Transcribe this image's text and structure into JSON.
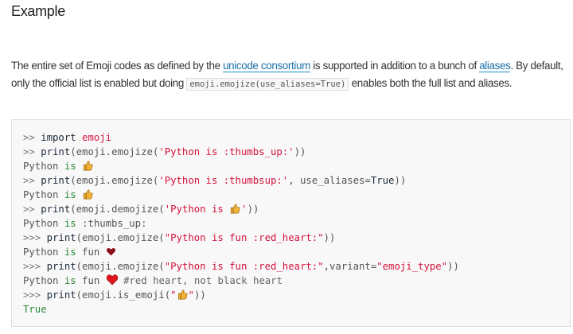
{
  "heading": "Example",
  "paragraph": {
    "t1": "The entire set of Emoji codes as defined by the ",
    "link1": "unicode consortium",
    "t2": " is supported in addition to a bunch of ",
    "link2": "aliases",
    "t3": ". By default, only the official list is enabled but doing ",
    "code": "emoji.emojize(use_aliases=True)",
    "t4": " enables both the full list and aliases."
  },
  "code_lines": [
    [
      [
        "p",
        ">> "
      ],
      [
        "k",
        "import"
      ],
      [
        "t",
        " "
      ],
      [
        "n",
        "emoji"
      ]
    ],
    [
      [
        "p",
        ">> "
      ],
      [
        "k",
        "print"
      ],
      [
        "t",
        "(emoji.emojize("
      ],
      [
        "s",
        "'Python is :thumbs_up:'"
      ],
      [
        "t",
        "))"
      ]
    ],
    [
      [
        "t",
        "Python "
      ],
      [
        "g",
        "is"
      ],
      [
        "t",
        " "
      ],
      [
        "thumb",
        "👍"
      ]
    ],
    [
      [
        "p",
        ">> "
      ],
      [
        "k",
        "print"
      ],
      [
        "t",
        "(emoji.emojize("
      ],
      [
        "s",
        "'Python is :thumbsup:'"
      ],
      [
        "t",
        ", use_aliases="
      ],
      [
        "k",
        "True"
      ],
      [
        "t",
        "))"
      ]
    ],
    [
      [
        "t",
        "Python "
      ],
      [
        "g",
        "is"
      ],
      [
        "t",
        " "
      ],
      [
        "thumb",
        "👍"
      ]
    ],
    [
      [
        "p",
        ">> "
      ],
      [
        "k",
        "print"
      ],
      [
        "t",
        "(emoji.demojize("
      ],
      [
        "s",
        "'Python is "
      ],
      [
        "thumb",
        "👍"
      ],
      [
        "s",
        "'"
      ],
      [
        "t",
        "))"
      ]
    ],
    [
      [
        "t",
        "Python "
      ],
      [
        "g",
        "is"
      ],
      [
        "t",
        " :thumbs_up:"
      ]
    ],
    [
      [
        "p",
        ">>> "
      ],
      [
        "k",
        "print"
      ],
      [
        "t",
        "(emoji.emojize("
      ],
      [
        "s",
        "\"Python is fun :red_heart:\""
      ],
      [
        "t",
        "))"
      ]
    ],
    [
      [
        "t",
        "Python "
      ],
      [
        "g",
        "is"
      ],
      [
        "t",
        " fun "
      ],
      [
        "heartdark",
        "♥"
      ]
    ],
    [
      [
        "p",
        ">>> "
      ],
      [
        "k",
        "print"
      ],
      [
        "t",
        "(emoji.emojize("
      ],
      [
        "s",
        "\"Python is fun :red_heart:\""
      ],
      [
        "t",
        ",variant="
      ],
      [
        "s",
        "\"emoji_type\""
      ],
      [
        "t",
        "))"
      ]
    ],
    [
      [
        "t",
        "Python "
      ],
      [
        "g",
        "is"
      ],
      [
        "t",
        " fun "
      ],
      [
        "heartred",
        "❤️"
      ],
      [
        "c",
        " #red heart, not black heart"
      ]
    ],
    [
      [
        "p",
        ">>> "
      ],
      [
        "k",
        "print"
      ],
      [
        "t",
        "(emoji.is_emoji("
      ],
      [
        "s",
        "\""
      ],
      [
        "thumb",
        "👍"
      ],
      [
        "s",
        "\""
      ],
      [
        "t",
        "))"
      ]
    ],
    [
      [
        "g",
        "True"
      ]
    ]
  ],
  "colors": {
    "link": "#1a6fa8",
    "string": "#d5123c",
    "keyword_green": "#2a8a3a",
    "thumb": "#f2b233",
    "heart_dark": "#8b0f1a",
    "heart_red": "#e0151f"
  }
}
